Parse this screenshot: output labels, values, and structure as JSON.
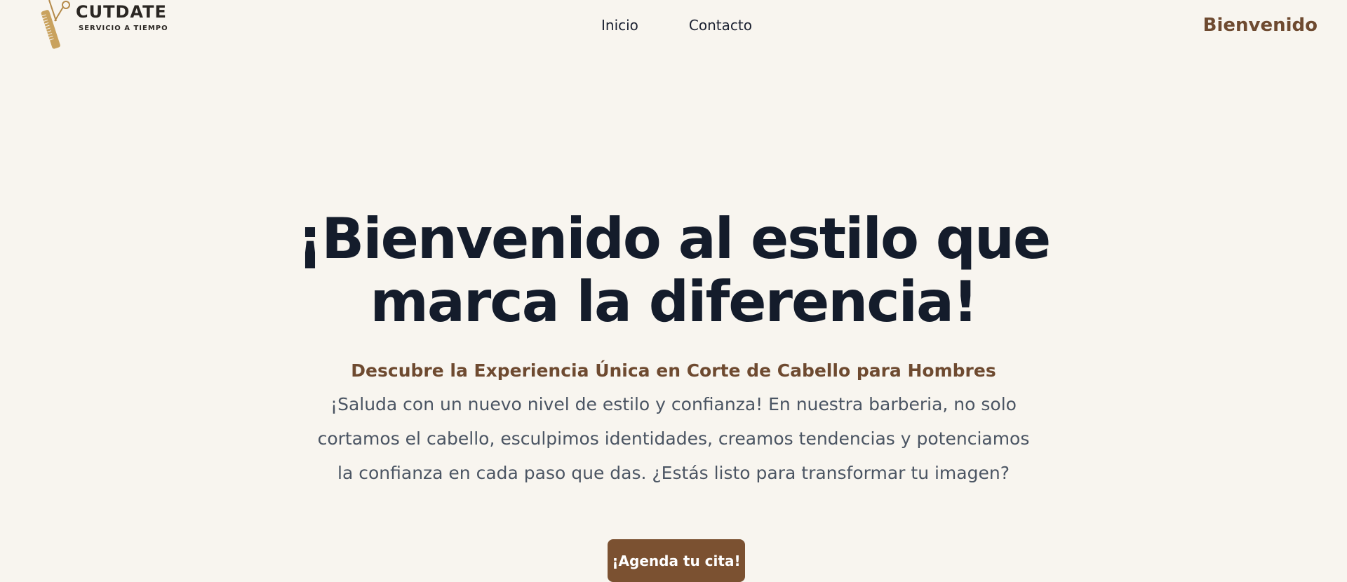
{
  "brand": {
    "name": "CUTDATE",
    "tagline": "SERVICIO A TIEMPO"
  },
  "nav": {
    "items": [
      {
        "label": "Inicio"
      },
      {
        "label": "Contacto"
      }
    ]
  },
  "header": {
    "welcome": "Bienvenido"
  },
  "hero": {
    "title": "¡Bienvenido al estilo que marca la diferencia!",
    "subtitle": "Descubre la Experiencia Única en Corte de Cabello para Hombres",
    "text": "¡Saluda con un nuevo nivel de estilo y confianza! En nuestra barberia, no solo cortamos el cabello, esculpimos identidades, creamos tendencias y potenciamos la confianza en cada paso que das. ¿Estás listo para transformar tu imagen?",
    "cta_label": "¡Agenda tu cita!"
  },
  "colors": {
    "background": "#f8f5ef",
    "accent": "#7b5131",
    "brown_text": "#6e4a30",
    "heading": "#141c2b",
    "body_text": "#4b5563",
    "logo_gold": "#c9a25e"
  },
  "icons": {
    "logo": "scissors-comb-icon"
  }
}
